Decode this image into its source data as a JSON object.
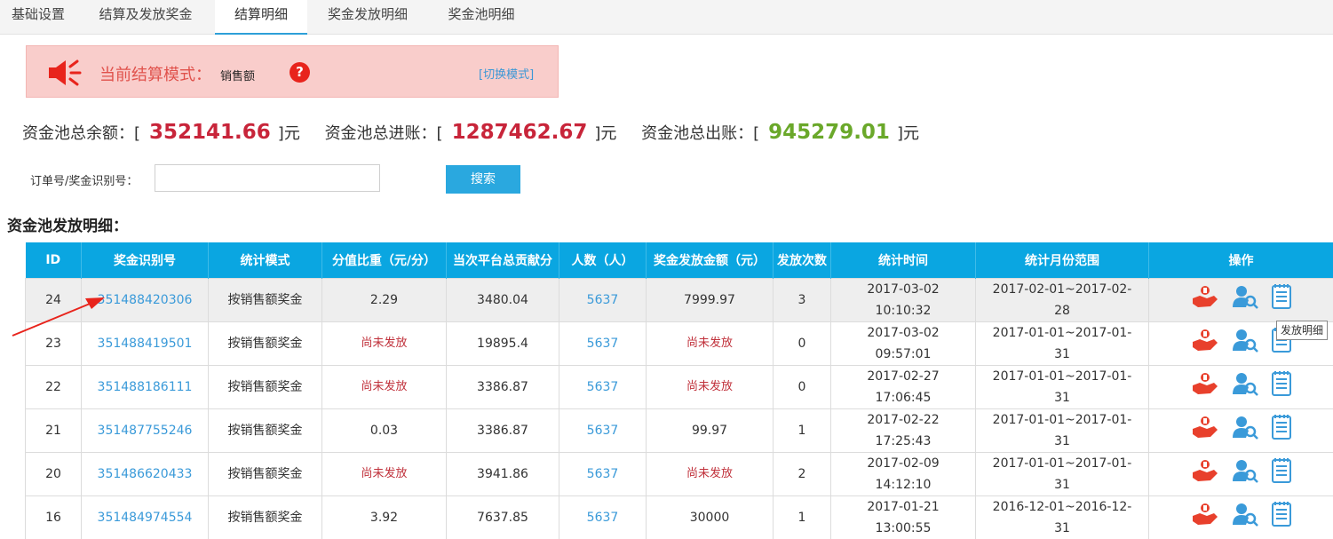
{
  "tabs": [
    {
      "label": "基础设置",
      "active": false
    },
    {
      "label": "结算及发放奖金",
      "active": false
    },
    {
      "label": "结算明细",
      "active": true
    },
    {
      "label": "奖金发放明细",
      "active": false
    },
    {
      "label": "奖金池明细",
      "active": false
    }
  ],
  "mode": {
    "label": "当前结算模式：",
    "value": "销售额",
    "help": "?",
    "switch_label": "[切换模式]"
  },
  "summary": {
    "balance_label": "资金池总余额：[",
    "balance": "352141.66",
    "income_label": "资金池总进账：[",
    "income": "1287462.67",
    "outgo_label": "资金池总出账：[",
    "outgo": "945279.01",
    "unit": "]元"
  },
  "search": {
    "label": "订单号/奖金识别号：",
    "value": "",
    "placeholder": "",
    "button": "搜索"
  },
  "section_title": "资金池发放明细：",
  "table": {
    "columns": [
      "ID",
      "奖金识别号",
      "统计模式",
      "分值比重（元/分）",
      "当次平台总贡献分",
      "人数（人）",
      "奖金发放金额（元）",
      "发放次数",
      "统计时间",
      "统计月份范围",
      "操作"
    ],
    "rows": [
      {
        "id": "24",
        "code": "351488420306",
        "mode": "按销售额奖金",
        "ratio": "2.29",
        "ratio_pending": false,
        "score": "3480.04",
        "people": "5637",
        "amount": "7999.97",
        "amount_pending": false,
        "times": "3",
        "time": "2017-03-02 10:10:32",
        "range": "2017-02-01~2017-02-28"
      },
      {
        "id": "23",
        "code": "351488419501",
        "mode": "按销售额奖金",
        "ratio": "尚未发放",
        "ratio_pending": true,
        "score": "19895.4",
        "people": "5637",
        "amount": "尚未发放",
        "amount_pending": true,
        "times": "0",
        "time": "2017-03-02 09:57:01",
        "range": "2017-01-01~2017-01-31"
      },
      {
        "id": "22",
        "code": "351488186111",
        "mode": "按销售额奖金",
        "ratio": "尚未发放",
        "ratio_pending": true,
        "score": "3386.87",
        "people": "5637",
        "amount": "尚未发放",
        "amount_pending": true,
        "times": "0",
        "time": "2017-02-27 17:06:45",
        "range": "2017-01-01~2017-01-31"
      },
      {
        "id": "21",
        "code": "351487755246",
        "mode": "按销售额奖金",
        "ratio": "0.03",
        "ratio_pending": false,
        "score": "3386.87",
        "people": "5637",
        "amount": "99.97",
        "amount_pending": false,
        "times": "1",
        "time": "2017-02-22 17:25:43",
        "range": "2017-01-01~2017-01-31"
      },
      {
        "id": "20",
        "code": "351486620433",
        "mode": "按销售额奖金",
        "ratio": "尚未发放",
        "ratio_pending": true,
        "score": "3941.86",
        "people": "5637",
        "amount": "尚未发放",
        "amount_pending": true,
        "times": "2",
        "time": "2017-02-09 14:12:10",
        "range": "2017-01-01~2017-01-31"
      },
      {
        "id": "16",
        "code": "351484974554",
        "mode": "按销售额奖金",
        "ratio": "3.92",
        "ratio_pending": false,
        "score": "7637.85",
        "people": "5637",
        "amount": "30000",
        "amount_pending": false,
        "times": "1",
        "time": "2017-01-21 13:00:55",
        "range": "2016-12-01~2016-12-31"
      }
    ],
    "ops_icons": [
      "hand-coin-icon",
      "user-search-icon",
      "document-list-icon"
    ],
    "highlight_row": 0
  },
  "tooltip": "发放明细",
  "colors": {
    "header": "#0aa6e1",
    "accent": "#2aa8df",
    "red": "#c8253a",
    "green": "#6aa82a",
    "banner": "#f9cdcb"
  }
}
